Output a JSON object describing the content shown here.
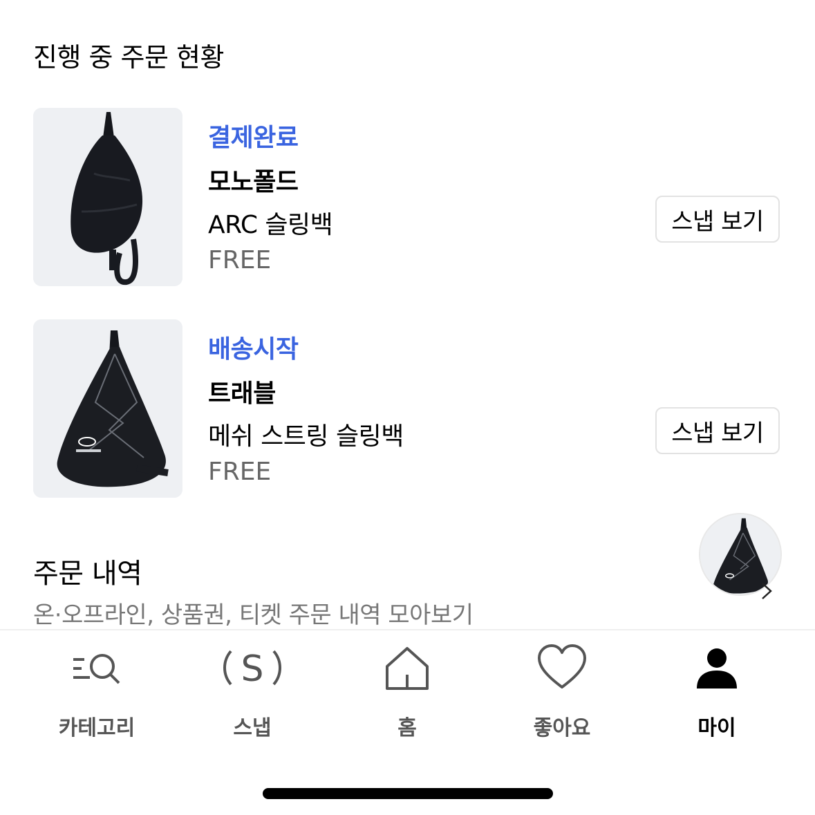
{
  "section_title": "진행 중 주문 현황",
  "orders": [
    {
      "status": "결제완료",
      "brand": "모노폴드",
      "name": "ARC 슬링백",
      "option": "FREE",
      "button": "스냅 보기"
    },
    {
      "status": "배송시작",
      "brand": "트래블",
      "name": "메쉬 스트링 슬링백",
      "option": "FREE",
      "button": "스냅 보기"
    }
  ],
  "history": {
    "title": "주문 내역",
    "subtitle": "온·오프라인, 상품권, 티켓 주문 내역 모아보기"
  },
  "tabbar": {
    "items": [
      {
        "label": "카테고리",
        "icon": "category-search-icon"
      },
      {
        "label": "스냅",
        "icon": "snap-s-icon"
      },
      {
        "label": "홈",
        "icon": "home-icon"
      },
      {
        "label": "좋아요",
        "icon": "heart-icon"
      },
      {
        "label": "마이",
        "icon": "person-icon",
        "active": true
      }
    ]
  },
  "colors": {
    "status": "#3a64e0",
    "active_tab": "#000000",
    "inactive_tab": "#555555"
  }
}
